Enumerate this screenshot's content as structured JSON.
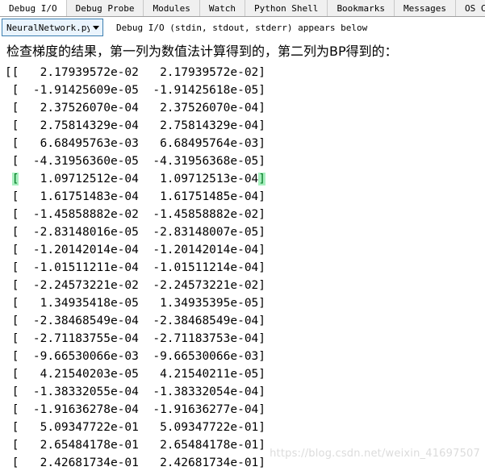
{
  "tabs": [
    {
      "label": "Debug I/O",
      "active": true
    },
    {
      "label": "Debug Probe",
      "active": false
    },
    {
      "label": "Modules",
      "active": false
    },
    {
      "label": "Watch",
      "active": false
    },
    {
      "label": "Python Shell",
      "active": false
    },
    {
      "label": "Bookmarks",
      "active": false
    },
    {
      "label": "Messages",
      "active": false
    },
    {
      "label": "OS Comman",
      "active": false
    }
  ],
  "toolbar": {
    "file_selector_value": "NeuralNetwork.py (",
    "file_selector_caret": "chevron-down-icon",
    "hint_text": "Debug I/O (stdin, stdout, stderr) appears below"
  },
  "console": {
    "chinese_note": "检查梯度的结果，第一列为数值法计算得到的，第二列为BP得到的：",
    "open_brackets": "[[",
    "highlighted_row_index": 6,
    "rows": [
      {
        "prefix": "[[",
        "col1": "2.17939572e-02",
        "col2": "2.17939572e-02",
        "suffix": "]"
      },
      {
        "prefix": " [",
        "col1": "-1.91425609e-05",
        "col2": "-1.91425618e-05",
        "suffix": "]"
      },
      {
        "prefix": " [",
        "col1": "2.37526070e-04",
        "col2": "2.37526070e-04",
        "suffix": "]"
      },
      {
        "prefix": " [",
        "col1": "2.75814329e-04",
        "col2": "2.75814329e-04",
        "suffix": "]"
      },
      {
        "prefix": " [",
        "col1": "6.68495763e-03",
        "col2": "6.68495764e-03",
        "suffix": "]"
      },
      {
        "prefix": " [",
        "col1": "-4.31956360e-05",
        "col2": "-4.31956368e-05",
        "suffix": "]"
      },
      {
        "prefix": " [",
        "col1": "1.09712512e-04",
        "col2": "1.09712513e-04",
        "suffix": "]"
      },
      {
        "prefix": " [",
        "col1": "1.61751483e-04",
        "col2": "1.61751485e-04",
        "suffix": "]"
      },
      {
        "prefix": " [",
        "col1": "-1.45858882e-02",
        "col2": "-1.45858882e-02",
        "suffix": "]"
      },
      {
        "prefix": " [",
        "col1": "-2.83148016e-05",
        "col2": "-2.83148007e-05",
        "suffix": "]"
      },
      {
        "prefix": " [",
        "col1": "-1.20142014e-04",
        "col2": "-1.20142014e-04",
        "suffix": "]"
      },
      {
        "prefix": " [",
        "col1": "-1.01511211e-04",
        "col2": "-1.01511214e-04",
        "suffix": "]"
      },
      {
        "prefix": " [",
        "col1": "-2.24573221e-02",
        "col2": "-2.24573221e-02",
        "suffix": "]"
      },
      {
        "prefix": " [",
        "col1": "1.34935418e-05",
        "col2": "1.34935395e-05",
        "suffix": "]"
      },
      {
        "prefix": " [",
        "col1": "-2.38468549e-04",
        "col2": "-2.38468549e-04",
        "suffix": "]"
      },
      {
        "prefix": " [",
        "col1": "-2.71183755e-04",
        "col2": "-2.71183753e-04",
        "suffix": "]"
      },
      {
        "prefix": " [",
        "col1": "-9.66530066e-03",
        "col2": "-9.66530066e-03",
        "suffix": "]"
      },
      {
        "prefix": " [",
        "col1": "4.21540203e-05",
        "col2": "4.21540211e-05",
        "suffix": "]"
      },
      {
        "prefix": " [",
        "col1": "-1.38332055e-04",
        "col2": "-1.38332054e-04",
        "suffix": "]"
      },
      {
        "prefix": " [",
        "col1": "-1.91636278e-04",
        "col2": "-1.91636277e-04",
        "suffix": "]"
      },
      {
        "prefix": " [",
        "col1": "5.09347722e-01",
        "col2": "5.09347722e-01",
        "suffix": "]"
      },
      {
        "prefix": " [",
        "col1": "2.65484178e-01",
        "col2": "2.65484178e-01",
        "suffix": "]"
      },
      {
        "prefix": " [",
        "col1": "2.42681734e-01",
        "col2": "2.42681734e-01",
        "suffix": "]"
      }
    ]
  },
  "watermark": {
    "text": "https://blog.csdn.net/weixin_41697507"
  },
  "colors": {
    "tab_active_bg": "#ffffff",
    "tab_inactive_bg": "#f0f0f0",
    "combo_border": "#3c7fb1",
    "combo_bg": "#eaf4fd",
    "bracket_highlight_bg": "#a8f0c0",
    "bracket_highlight_fg": "#007820",
    "watermark_fg": "#dcdcdc"
  }
}
